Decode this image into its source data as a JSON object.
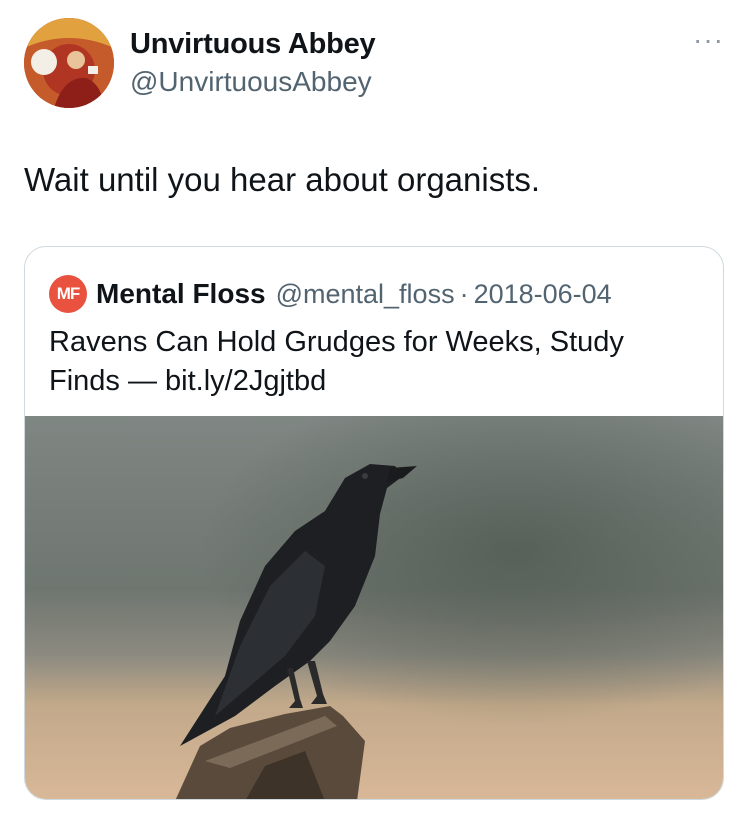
{
  "tweet": {
    "author_name": "Unvirtuous Abbey",
    "author_handle": "@UnvirtuousAbbey",
    "more_icon": "more-horizontal-icon",
    "more_label": "···",
    "text": "Wait until you hear about organists."
  },
  "quoted_tweet": {
    "avatar_initials": "MF",
    "avatar_color": "#e8523f",
    "author_name": "Mental Floss",
    "author_handle": "@mental_floss",
    "separator": "·",
    "date": "2018-06-04",
    "text": "Ravens Can Hold Grudges for Weeks, Study Finds — bit.ly/2Jgjtbd"
  }
}
